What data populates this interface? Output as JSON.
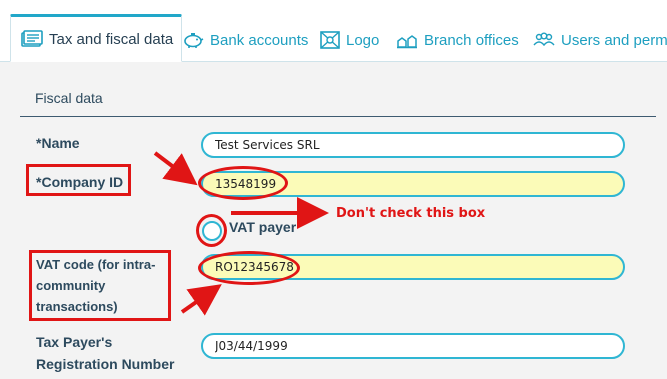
{
  "tabs": [
    {
      "label": "Tax and fiscal data",
      "icon": "tax-document-icon",
      "active": true
    },
    {
      "label": "Bank accounts",
      "icon": "piggy-bank-icon",
      "active": false
    },
    {
      "label": "Logo",
      "icon": "logo-image-icon",
      "active": false
    },
    {
      "label": "Branch offices",
      "icon": "branch-offices-icon",
      "active": false
    },
    {
      "label": "Users and permiss",
      "icon": "users-icon",
      "active": false
    }
  ],
  "section": {
    "title": "Fiscal data"
  },
  "form": {
    "name": {
      "required": "*",
      "label": "Name",
      "value": "Test Services SRL"
    },
    "company_id": {
      "required": "*",
      "label": "Company ID",
      "value": "13548199"
    },
    "vat_payer": {
      "label": "VAT payer",
      "checked": false
    },
    "vat_code": {
      "label_lines": [
        "VAT code (for intra-",
        "community",
        "transactions)"
      ],
      "value": "RO12345678"
    },
    "tax_reg": {
      "label_lines": [
        "Tax Payer's",
        "Registration Number"
      ],
      "value": "J03/44/1999"
    }
  },
  "annotation": {
    "note": "Don't check this box",
    "color": "#e01515"
  },
  "colors": {
    "accent": "#21a7c9",
    "highlight": "#fbfbb8",
    "panel": "#f3f3f3"
  }
}
